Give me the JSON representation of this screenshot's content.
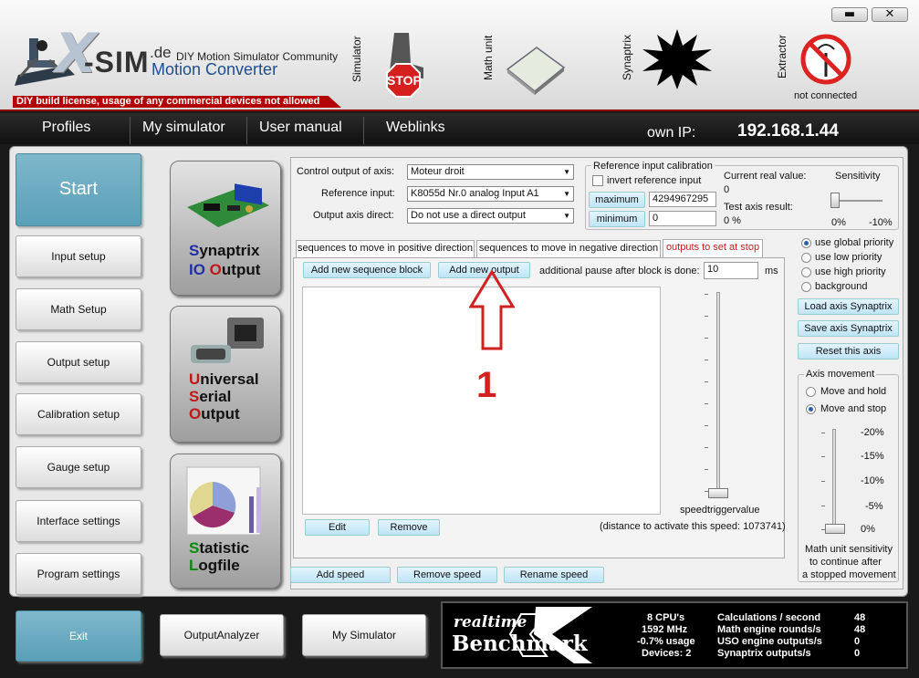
{
  "header": {
    "logo_x": "X",
    "logo_sim": "-SIM",
    "logo_de": ".de",
    "community": "DIY Motion Simulator Community",
    "product": "Motion Converter",
    "license": "DIY build license, usage of any commercial devices not allowed",
    "modules": {
      "simulator": "Simulator",
      "stop": "STOP",
      "math_unit": "Math unit",
      "synaptrix": "Synaptrix",
      "extractor": "Extractor"
    },
    "extractor_status": "not connected",
    "minimize": "▬",
    "close": "✕"
  },
  "menu": {
    "items": [
      "Profiles",
      "My simulator",
      "User manual",
      "Weblinks"
    ],
    "own_ip_label": "own IP:",
    "own_ip": "192.168.1.44"
  },
  "left_buttons": {
    "start": "Start",
    "input_setup": "Input setup",
    "math_setup": "Math Setup",
    "output_setup": "Output setup",
    "calibration_setup": "Calibration setup",
    "gauge_setup": "Gauge setup",
    "interface_settings": "Interface settings",
    "program_settings": "Program settings",
    "exit": "Exit"
  },
  "tiles": {
    "synaptrix": {
      "l1a": "S",
      "l1b": "ynaptrix",
      "l2a": "IO ",
      "l2b": "O",
      "l2c": "utput"
    },
    "uso": {
      "l1a": "U",
      "l1b": "niversal",
      "l2a": "S",
      "l2b": "erial",
      "l3a": "O",
      "l3b": "utput"
    },
    "stat": {
      "l1a": "S",
      "l1b": "tatistic",
      "l2a": "L",
      "l2b": "ogfile"
    }
  },
  "config": {
    "control_output_label": "Control output of axis:",
    "control_output_value": "Moteur droit",
    "reference_input_label": "Reference input:",
    "reference_input_value": "K8055d Nr.0 analog Input A1",
    "output_axis_direct_label": "Output axis direct:",
    "output_axis_direct_value": "Do not use a direct output",
    "calibration": {
      "title": "Reference input calibration",
      "invert_label": "invert reference input",
      "maximum_btn": "maximum",
      "maximum_value": "4294967295",
      "minimum_btn": "minimum",
      "minimum_value": "0",
      "current_real_value_label": "Current real value:",
      "current_real_value": "0",
      "test_axis_label": "Test axis result:",
      "test_axis_value": "0 %",
      "sensitivity_label": "Sensitivity",
      "sens_min": "0%",
      "sens_max": "-10%"
    },
    "tabs": [
      "sequences to move in positive direction",
      "sequences to move in negative direction",
      "outputs to set at stop"
    ],
    "add_sequence_block": "Add new sequence block",
    "add_new_output": "Add new output",
    "pause_label": "additional pause after block is done:",
    "pause_value": "10",
    "pause_unit": "ms",
    "speedtrigger_label": "speedtriggervalue",
    "edit": "Edit",
    "remove": "Remove",
    "distance_note": "(distance to activate this speed: 1073741)",
    "add_speed": "Add speed",
    "remove_speed": "Remove speed",
    "rename_speed": "Rename speed",
    "annotation_number": "1"
  },
  "priority": {
    "options": [
      "use global priority",
      "use low priority",
      "use high priority",
      "background"
    ],
    "selected": 0,
    "load_axis": "Load axis Synaptrix",
    "save_axis": "Save axis Synaptrix",
    "reset_axis": "Reset this axis"
  },
  "axis_movement": {
    "title": "Axis movement",
    "move_hold": "Move and hold",
    "move_stop": "Move and stop",
    "ticks": [
      "-20%",
      "-15%",
      "-10%",
      "-5%",
      "0%"
    ],
    "note_l1": "Math unit sensitivity",
    "note_l2": "to continue after",
    "note_l3": "a stopped movement"
  },
  "bottom": {
    "output_analyzer": "OutputAnalyzer",
    "my_simulator": "My Simulator"
  },
  "benchmark": {
    "logo_top": "realtime",
    "logo_bottom": "Benchmark",
    "cpus": "8 CPU's",
    "mhz": "1592 MHz",
    "usage": "-0.7% usage",
    "devices": "Devices: 2",
    "calc_label": "Calculations / second",
    "calc_value": "48",
    "math_label": "Math engine rounds/s",
    "math_value": "48",
    "uso_label": "USO engine outputs/s",
    "uso_value": "0",
    "syn_label": "Synaptrix outputs/s",
    "syn_value": "0"
  },
  "colors": {
    "accent_blue": "#5a9fb8",
    "annotation_red": "#d02020",
    "license_red": "#b30000"
  }
}
